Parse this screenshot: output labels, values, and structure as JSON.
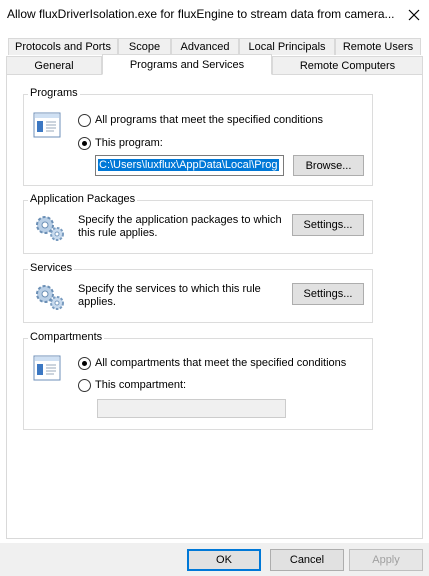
{
  "window": {
    "title": "Allow fluxDriverIsolation.exe for fluxEngine to stream data from camera...",
    "close_icon": "close-icon"
  },
  "tabs": {
    "row_top": [
      "Protocols and Ports",
      "Scope",
      "Advanced",
      "Local Principals",
      "Remote Users"
    ],
    "row_bottom": [
      "General",
      "Programs and Services",
      "Remote Computers"
    ],
    "active": "Programs and Services"
  },
  "programs": {
    "label": "Programs",
    "all_programs_label": "All programs that meet the specified conditions",
    "this_program_label": "This program:",
    "selected": "this_program",
    "path_value": "C:\\Users\\luxflux\\AppData\\Local\\Prog",
    "browse_label": "Browse..."
  },
  "app_packages": {
    "label": "Application Packages",
    "description_line1": "Specify the application packages to which",
    "description_line2": "this rule applies.",
    "settings_label": "Settings..."
  },
  "services": {
    "label": "Services",
    "description_line1": "Specify the services to which this rule",
    "description_line2": "applies.",
    "settings_label": "Settings..."
  },
  "compartments": {
    "label": "Compartments",
    "all_label": "All compartments that meet the specified conditions",
    "this_label": "This compartment:",
    "selected": "all",
    "compartment_value": ""
  },
  "footer": {
    "ok_label": "OK",
    "cancel_label": "Cancel",
    "apply_label": "Apply"
  }
}
